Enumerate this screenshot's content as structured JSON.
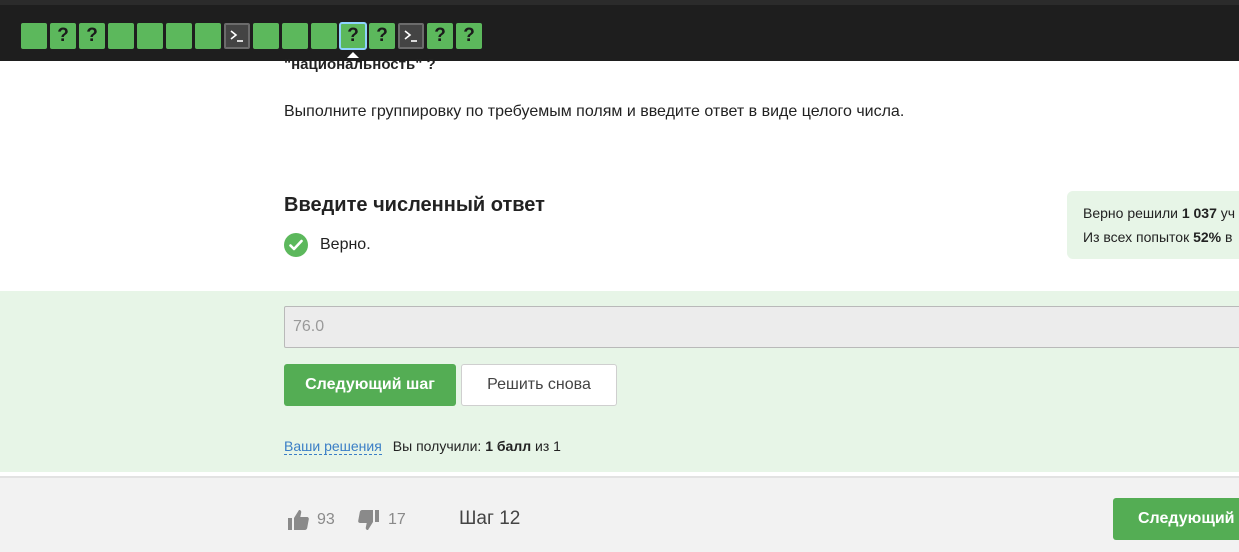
{
  "step_bar": {
    "steps": [
      {
        "kind": "solved",
        "label": ""
      },
      {
        "kind": "question",
        "label": "?"
      },
      {
        "kind": "question",
        "label": "?"
      },
      {
        "kind": "solved",
        "label": ""
      },
      {
        "kind": "solved",
        "label": ""
      },
      {
        "kind": "solved",
        "label": ""
      },
      {
        "kind": "solved",
        "label": ""
      },
      {
        "kind": "terminal",
        "label": ""
      },
      {
        "kind": "solved",
        "label": ""
      },
      {
        "kind": "solved",
        "label": ""
      },
      {
        "kind": "solved",
        "label": ""
      },
      {
        "kind": "question-current",
        "label": "?"
      },
      {
        "kind": "question",
        "label": "?"
      },
      {
        "kind": "terminal",
        "label": ""
      },
      {
        "kind": "question",
        "label": "?"
      },
      {
        "kind": "question",
        "label": "?"
      }
    ]
  },
  "question": {
    "tail": "\"национальность\" ?",
    "instruction": "Выполните группировку по требуемым полям и введите ответ в виде целого числа."
  },
  "answer": {
    "heading": "Введите численный ответ",
    "status": "Верно.",
    "value": "76.0"
  },
  "stats": {
    "line1_prefix": "Верно решили ",
    "line1_count": "1 037",
    "line1_suffix": " уч",
    "line2_prefix": "Из всех попыток ",
    "line2_percent": "52%",
    "line2_suffix": " в"
  },
  "buttons": {
    "next": "Следующий шаг",
    "retry": "Решить снова",
    "footer_next": "Следующий ш"
  },
  "solutions": {
    "link": "Ваши решения",
    "received_prefix": "Вы получили: ",
    "received_points": "1 балл",
    "received_suffix": " из 1"
  },
  "footer": {
    "likes": "93",
    "dislikes": "17",
    "step": "Шаг 12"
  }
}
